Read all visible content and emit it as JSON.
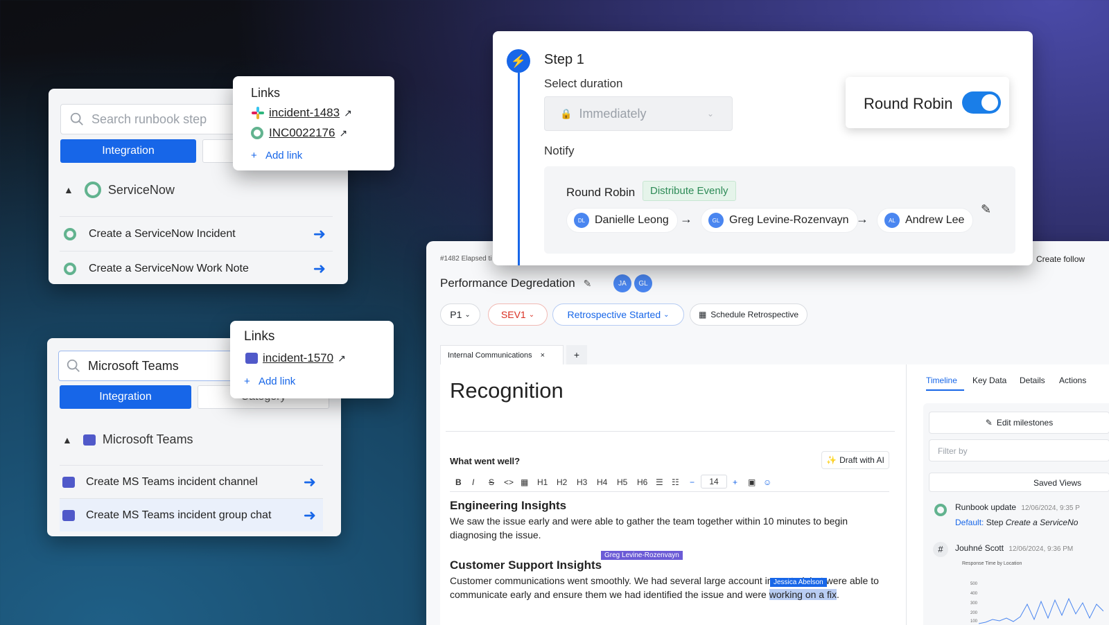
{
  "card1": {
    "search_placeholder": "Search runbook step",
    "integration_btn": "Integration",
    "group_name": "ServiceNow",
    "items": [
      "Create a ServiceNow Incident",
      "Create a ServiceNow Work Note"
    ]
  },
  "links1": {
    "title": "Links",
    "items": [
      "incident-1483",
      "INC0022176"
    ],
    "add_link": "Add link"
  },
  "card2": {
    "search_value": "Microsoft Teams",
    "integration_btn": "Integration",
    "category_btn": "Category",
    "group_name": "Microsoft Teams",
    "items": [
      "Create MS Teams incident channel",
      "Create MS Teams incident group chat"
    ]
  },
  "links2": {
    "title": "Links",
    "items": [
      "incident-1570"
    ],
    "add_link": "Add link"
  },
  "step": {
    "title": "Step 1",
    "duration_label": "Select duration",
    "duration_value": "Immediately",
    "notify_label": "Notify",
    "rr_title": "Round Robin",
    "rr_badge": "Distribute Evenly",
    "toggle_label": "Round Robin",
    "people": [
      {
        "initials": "DL",
        "name": "Danielle Leong"
      },
      {
        "initials": "GL",
        "name": "Greg Levine-Rozenvayn"
      },
      {
        "initials": "AL",
        "name": "Andrew Lee"
      }
    ]
  },
  "incident": {
    "meta": "#1482 Elapsed ti",
    "create_follow": "Create follow",
    "title": "Performance Degredation",
    "avatars": [
      "JA",
      "GL"
    ],
    "priority": "P1",
    "severity": "SEV1",
    "status": "Retrospective Started",
    "schedule": "Schedule Retrospective",
    "tab": "Internal Communications",
    "tab_add": "+",
    "heading": "Recognition",
    "question": "What went well?",
    "draft_ai": "Draft with AI",
    "font_size": "14",
    "toolbar": [
      "B",
      "I",
      "S",
      "<>",
      "▦",
      "H1",
      "H2",
      "H3",
      "H4",
      "H5",
      "H6",
      "☰",
      "☷",
      "−"
    ],
    "sec1_title": "Engineering Insights",
    "sec1_body": "We saw the issue early and were able to gather the team together within 10 minutes to begin diagnosing the issue.",
    "sec2_title": "Customer Support Insights",
    "sec2_body_a": "Customer communications went smoothly. We had several large account i",
    "sec2_body_b": "mpacted, but",
    "sec2_body_c": " were able to communicate early and ensure them we had identified the issue and were ",
    "sec2_body_d": "working on a fix",
    "sec2_body_e": ".",
    "cursor_greg": "Greg Levine-Rozenvayn",
    "cursor_jessica": "Jessica Abelson",
    "side_tabs": [
      "Timeline",
      "Key Data",
      "Details",
      "Actions"
    ],
    "edit_milestones": "Edit milestones",
    "filter_placeholder": "Filter by",
    "saved_views": "Saved Views",
    "ev1_title": "Runbook update",
    "ev1_time": "12/06/2024, 9:35 P",
    "ev1_default": "Default:",
    "ev1_text": "Step",
    "ev1_italic": "Create a ServiceNo",
    "ev2_title": "Jouhné Scott",
    "ev2_time": "12/06/2024, 9:36 PM",
    "chart_title": "Response Time by Location",
    "chart_ticks": [
      "500",
      "400",
      "300",
      "200",
      "100"
    ]
  },
  "colors": {
    "accent": "#1766e8",
    "success": "#2e8b57",
    "danger": "#d92d20"
  }
}
